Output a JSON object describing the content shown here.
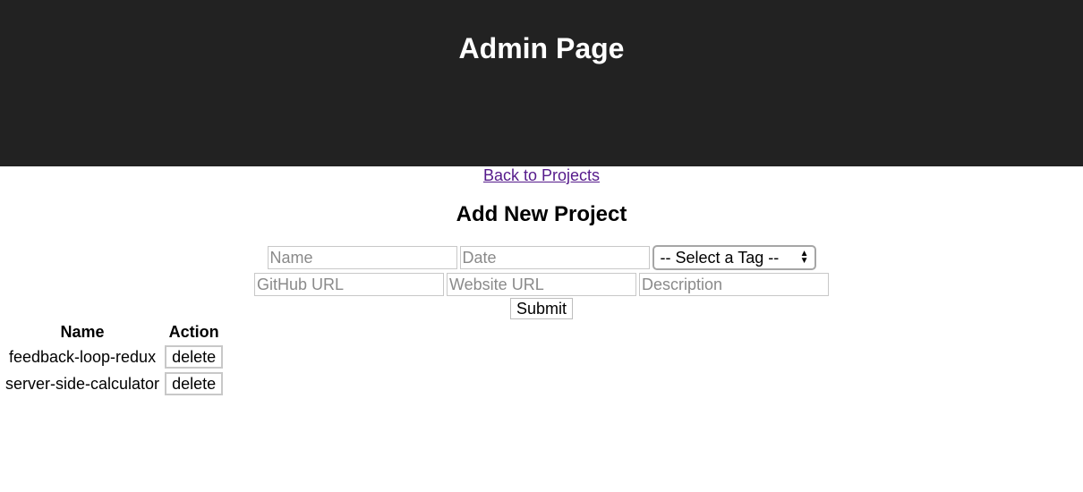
{
  "header": {
    "title": "Admin Page"
  },
  "nav": {
    "back_link": "Back to Projects"
  },
  "form": {
    "title": "Add New Project",
    "name_placeholder": "Name",
    "date_placeholder": "Date",
    "tag_select_value": "-- Select a Tag --",
    "github_placeholder": "GitHub URL",
    "website_placeholder": "Website URL",
    "description_placeholder": "Description",
    "submit_label": "Submit"
  },
  "table": {
    "headers": [
      "Name",
      "Action"
    ],
    "rows": [
      {
        "name": "feedback-loop-redux",
        "action": "delete"
      },
      {
        "name": "server-side-calculator",
        "action": "delete"
      }
    ]
  },
  "colors": {
    "header_bg": "#222222",
    "header_text": "#ffffff",
    "link_visited": "#551a8b"
  }
}
